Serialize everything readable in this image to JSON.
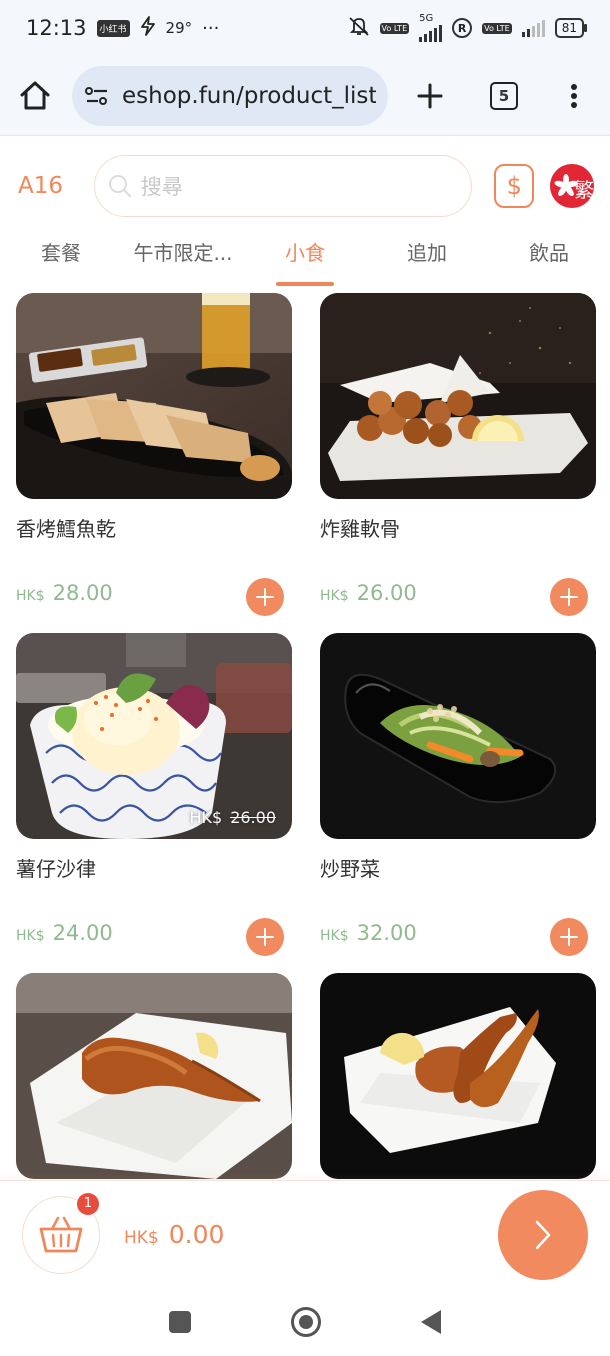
{
  "status_bar": {
    "time": "12:13",
    "app_badge": "小红书",
    "temperature": "29°",
    "more": "···",
    "network": "5G",
    "volte": "Vo LTE",
    "roaming": "R",
    "battery": "81"
  },
  "browser": {
    "url": "eshop.fun/product_list?",
    "tab_count": "5"
  },
  "header": {
    "table_no": "A16",
    "search_placeholder": "搜尋",
    "coin_symbol": "$",
    "language": "繁"
  },
  "categories": [
    {
      "label": "套餐",
      "active": false
    },
    {
      "label": "午市限定...",
      "active": false
    },
    {
      "label": "小食",
      "active": true
    },
    {
      "label": "追加",
      "active": false
    },
    {
      "label": "飲品",
      "active": false
    }
  ],
  "products": [
    {
      "name": "香烤鱈魚乾",
      "currency": "HK$",
      "price": "28.00"
    },
    {
      "name": "炸雞軟骨",
      "currency": "HK$",
      "price": "26.00"
    },
    {
      "name": "薯仔沙律",
      "currency": "HK$",
      "price": "24.00",
      "original_currency": "HK$",
      "original_price": "26.00"
    },
    {
      "name": "炒野菜",
      "currency": "HK$",
      "price": "32.00"
    },
    {
      "name": "",
      "currency": "",
      "price": ""
    },
    {
      "name": "",
      "currency": "",
      "price": ""
    }
  ],
  "cart": {
    "badge": "1",
    "currency": "HK$",
    "total": "0.00"
  },
  "colors": {
    "accent": "#f0875a",
    "price_green": "#8fb98f",
    "badge_red": "#e94b3c"
  }
}
